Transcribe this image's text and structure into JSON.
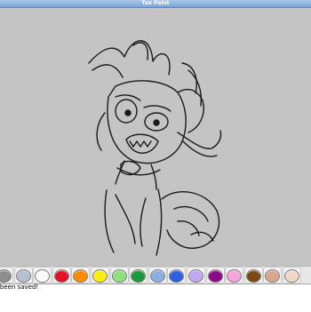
{
  "window": {
    "title": "Tux Paint"
  },
  "palette": {
    "colors": [
      {
        "name": "gray",
        "hex": "#8c8c8c"
      },
      {
        "name": "light-gray",
        "hex": "#b5c1d1"
      },
      {
        "name": "white",
        "hex": "#ffffff"
      },
      {
        "name": "red",
        "hex": "#e0152b"
      },
      {
        "name": "orange",
        "hex": "#ff8a00"
      },
      {
        "name": "yellow",
        "hex": "#ffef10"
      },
      {
        "name": "light-green",
        "hex": "#8fe07d"
      },
      {
        "name": "green",
        "hex": "#1a9a3a"
      },
      {
        "name": "sky-blue",
        "hex": "#8bb0df"
      },
      {
        "name": "blue",
        "hex": "#2f5fe0"
      },
      {
        "name": "lavender",
        "hex": "#c0a8f0"
      },
      {
        "name": "purple",
        "hex": "#8a0a8a"
      },
      {
        "name": "pink",
        "hex": "#f5a6d8"
      },
      {
        "name": "brown",
        "hex": "#7a4a12"
      },
      {
        "name": "tan",
        "hex": "#d9a690"
      },
      {
        "name": "beige",
        "hex": "#f0d8c8"
      }
    ]
  },
  "status": {
    "message": "s been saved!"
  }
}
